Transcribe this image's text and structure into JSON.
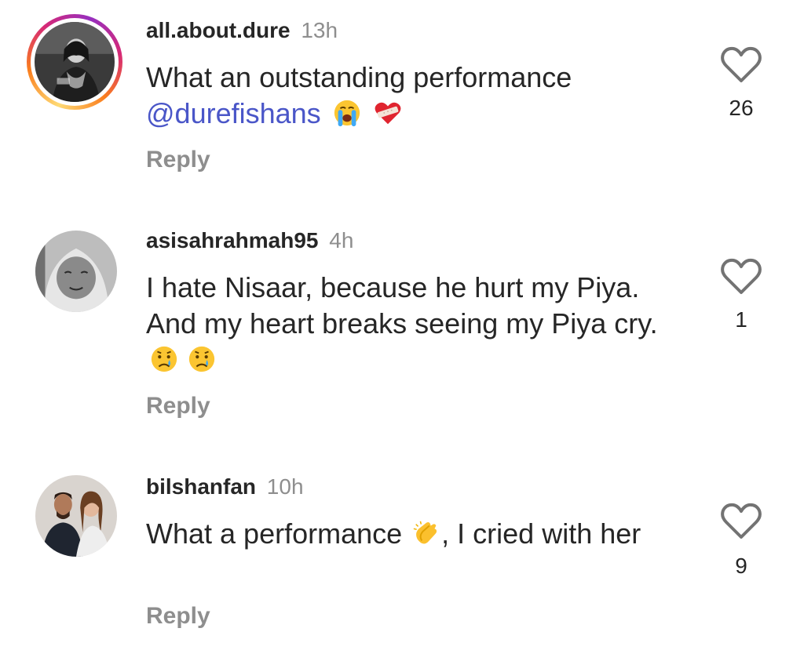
{
  "comments": [
    {
      "username": "all.about.dure",
      "time": "13h",
      "text": "What an outstanding performance",
      "mention": "@durefishans",
      "emojis": [
        "loudly-crying-face-emoji",
        "mending-heart-emoji"
      ],
      "reply_label": "Reply",
      "likes": "26",
      "avatar_story_ring": true
    },
    {
      "username": "asisahrahmah95",
      "time": "4h",
      "text": "I hate Nisaar, because he hurt my Piya. And my heart breaks seeing my Piya cry.",
      "emojis": [
        "crying-face-emoji",
        "crying-face-emoji"
      ],
      "reply_label": "Reply",
      "likes": "1",
      "avatar_story_ring": false
    },
    {
      "username": "bilshanfan",
      "time": "10h",
      "text_before": "What a performance",
      "text_after": ", I cried with her",
      "emojis": [
        "clapping-hands-emoji"
      ],
      "reply_label": "Reply",
      "likes": "9",
      "avatar_story_ring": false
    }
  ],
  "colors": {
    "text": "#262626",
    "secondary": "#8e8e8e",
    "mention": "#4a56c8"
  },
  "icons": {
    "like": "heart-outline-icon"
  }
}
